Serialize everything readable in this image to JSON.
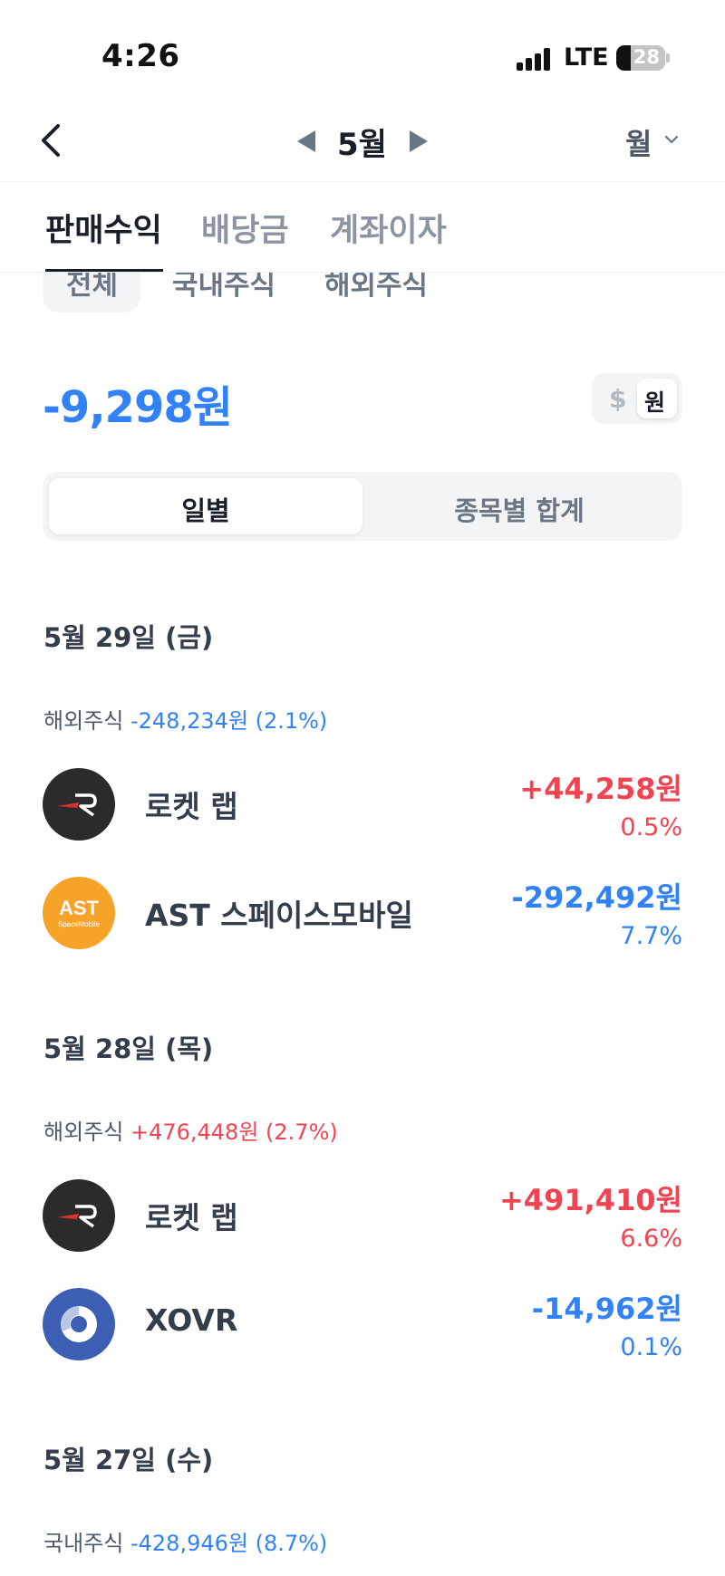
{
  "status_bar": {
    "time": "4:26",
    "network": "LTE",
    "battery": "28"
  },
  "header": {
    "month": "5월",
    "period": "월"
  },
  "tabs": [
    {
      "label": "판매수익",
      "active": true
    },
    {
      "label": "배당금",
      "active": false
    },
    {
      "label": "계좌이자",
      "active": false
    }
  ],
  "subtabs": [
    "전체",
    "국내주식",
    "해외주식"
  ],
  "summary": {
    "total": "-9,298원",
    "currency_dollar": "$",
    "currency_won": "원"
  },
  "view_toggle": {
    "daily": "일별",
    "by_stock": "종목별 합계"
  },
  "days": [
    {
      "date": "5월 29일 (금)",
      "market": "해외주식",
      "market_change": "-248,234원 (2.1%)",
      "items": [
        {
          "name": "로켓 랩",
          "logo": "rocket-lab-logo",
          "amount": "+44,258원",
          "rate": "0.5%"
        },
        {
          "name": "AST 스페이스모바일",
          "logo": "ast-spacemobile-logo",
          "amount": "-292,492원",
          "rate": "7.7%"
        }
      ]
    },
    {
      "date": "5월 28일 (목)",
      "market": "해외주식",
      "market_change": "+476,448원 (2.7%)",
      "items": [
        {
          "name": "로켓 랩",
          "logo": "rocket-lab-logo",
          "amount": "+491,410원",
          "rate": "6.6%"
        },
        {
          "name": "XOVR",
          "logo": "xovr-logo",
          "amount": "-14,962원",
          "rate": "0.1%"
        }
      ]
    },
    {
      "date": "5월 27일 (수)",
      "market": "국내주식",
      "market_change": "-428,946원 (8.7%)",
      "items": []
    }
  ],
  "logo_text": {
    "ast_main": "AST",
    "ast_sub": "SpaceMobile"
  },
  "colors": {
    "positive": "#f04452",
    "negative": "#3182f6",
    "text": "#333d4b"
  }
}
